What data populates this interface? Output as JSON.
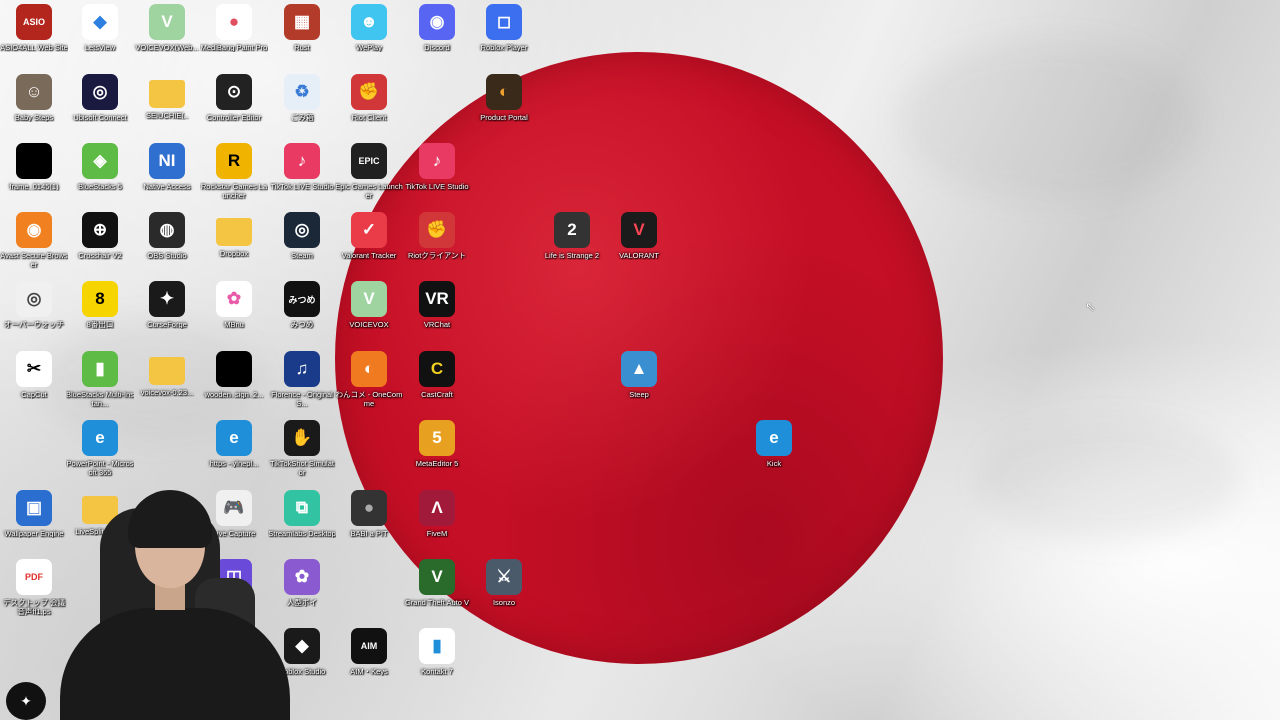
{
  "desktop": {
    "icons": [
      {
        "label": "ASIO4ALL Web Site",
        "text": "ASIO",
        "bg": "#b3261e",
        "fg": "#ffffff"
      },
      {
        "label": "LetsView",
        "text": "◆",
        "bg": "#ffffff",
        "fg": "#2d7fe0"
      },
      {
        "label": "VOICEVOX(Web...",
        "text": "V",
        "bg": "#9fd4a0",
        "fg": "#ffffff"
      },
      {
        "label": "MediBang Paint Pro",
        "text": "●",
        "bg": "#ffffff",
        "fg": "#e04f5f"
      },
      {
        "label": "Rust",
        "text": "▦",
        "bg": "#b33b2a",
        "fg": "#ffffff"
      },
      {
        "label": "WePlay",
        "text": "☻",
        "bg": "#40c4f0",
        "fg": "#ffffff"
      },
      {
        "label": "Discord",
        "text": "◉",
        "bg": "#5865f2",
        "fg": "#ffffff"
      },
      {
        "label": "Roblox Player",
        "text": "◻",
        "bg": "#3b6ff0",
        "fg": "#ffffff"
      },
      {
        "label": "Baby Steps",
        "text": "☺",
        "bg": "#7a6a5a",
        "fg": "#ffffff"
      },
      {
        "label": "Ubisoft Connect",
        "text": "◎",
        "bg": "#1a1a40",
        "fg": "#ffffff"
      },
      {
        "label": "SEIUCHIE(..",
        "text": "",
        "bg": "#f4c542",
        "fg": "#ffffff"
      },
      {
        "label": "Controller Editor",
        "text": "⊙",
        "bg": "#222222",
        "fg": "#ffffff"
      },
      {
        "label": "ごみ箱",
        "text": "♻",
        "bg": "#e6eef8",
        "fg": "#3a7bd5"
      },
      {
        "label": "Riot Client",
        "text": "✊",
        "bg": "#d13639",
        "fg": "#ffffff"
      },
      {
        "label": "Product Portal",
        "text": "◐",
        "bg": "#3a2a1a",
        "fg": "#f0a030"
      },
      {
        "label": "frame_0145(1)",
        "text": "",
        "bg": "#000000",
        "fg": "#ffffff"
      },
      {
        "label": "BlueStacks 5",
        "text": "◈",
        "bg": "#5dbb46",
        "fg": "#ffffff"
      },
      {
        "label": "Native Access",
        "text": "NI",
        "bg": "#2f6fd0",
        "fg": "#ffffff"
      },
      {
        "label": "Rockstar Games Launcher",
        "text": "R",
        "bg": "#f0b400",
        "fg": "#000000"
      },
      {
        "label": "TikTok LIVE Studio",
        "text": "♪",
        "bg": "#e93a63",
        "fg": "#ffffff"
      },
      {
        "label": "Epic Games Launcher",
        "text": "EPIC",
        "bg": "#202020",
        "fg": "#ffffff"
      },
      {
        "label": "TikTok LIVE Studio",
        "text": "♪",
        "bg": "#e93a63",
        "fg": "#ffffff"
      },
      {
        "label": "Avast Secure Browser",
        "text": "◉",
        "bg": "#f08020",
        "fg": "#ffffff"
      },
      {
        "label": "Crosshair V2",
        "text": "⊕",
        "bg": "#111111",
        "fg": "#ffffff"
      },
      {
        "label": "OBS Studio",
        "text": "◍",
        "bg": "#2a2a2a",
        "fg": "#ffffff"
      },
      {
        "label": "Dropbox",
        "text": "",
        "bg": "#f4c542",
        "fg": "#ffffff"
      },
      {
        "label": "Steam",
        "text": "◎",
        "bg": "#1b2838",
        "fg": "#ffffff"
      },
      {
        "label": "Valorant Tracker",
        "text": "✓",
        "bg": "#ea3b48",
        "fg": "#ffffff"
      },
      {
        "label": "Riotクライアント",
        "text": "✊",
        "bg": "#d13639",
        "fg": "#ffffff"
      },
      {
        "label": "Life is Strange 2",
        "text": "2",
        "bg": "#333333",
        "fg": "#ffffff"
      },
      {
        "label": "VALORANT",
        "text": "V",
        "bg": "#1b1b1b",
        "fg": "#ff4655"
      },
      {
        "label": "オーバーウォッチ",
        "text": "◎",
        "bg": "#f0f0f0",
        "fg": "#444444"
      },
      {
        "label": "8番出口",
        "text": "8",
        "bg": "#f5d400",
        "fg": "#000000"
      },
      {
        "label": "CurseForge",
        "text": "✦",
        "bg": "#1a1a1a",
        "fg": "#ffffff"
      },
      {
        "label": "MBnu",
        "text": "✿",
        "bg": "#ffffff",
        "fg": "#e85aa8"
      },
      {
        "label": "みつめ",
        "text": "みつめ",
        "bg": "#111111",
        "fg": "#ffffff"
      },
      {
        "label": "VOICEVOX",
        "text": "V",
        "bg": "#9fd4a0",
        "fg": "#ffffff"
      },
      {
        "label": "VRChat",
        "text": "VR",
        "bg": "#111111",
        "fg": "#ffffff"
      },
      {
        "label": "CapCut",
        "text": "✂",
        "bg": "#ffffff",
        "fg": "#000000"
      },
      {
        "label": "BlueStacks Multi-Instan...",
        "text": "▮",
        "bg": "#5dbb46",
        "fg": "#ffffff"
      },
      {
        "label": "voicevox-0.23...",
        "text": "",
        "bg": "#f4c542",
        "fg": "#ffffff"
      },
      {
        "label": "wooden_sign_2...",
        "text": "",
        "bg": "#000000",
        "fg": "#ffffff"
      },
      {
        "label": "Florence - Original S...",
        "text": "♫",
        "bg": "#1a3a8a",
        "fg": "#ffffff"
      },
      {
        "label": "わんコメ - OneComme",
        "text": "◐",
        "bg": "#f07a20",
        "fg": "#ffffff"
      },
      {
        "label": "CastCraft",
        "text": "C",
        "bg": "#111111",
        "fg": "#f0d020"
      },
      {
        "label": "Steep",
        "text": "▲",
        "bg": "#3a8fd0",
        "fg": "#ffffff"
      },
      {
        "label": "PowerPoint - Microsoft 365",
        "text": "e",
        "bg": "#1e8fd8",
        "fg": "#ffffff"
      },
      {
        "label": "https - ylnepl...",
        "text": "e",
        "bg": "#1e8fd8",
        "fg": "#ffffff"
      },
      {
        "label": "TikTokShot Simulator",
        "text": "✋",
        "bg": "#1a1a1a",
        "fg": "#ffffff"
      },
      {
        "label": "MetaEditor 5",
        "text": "5",
        "bg": "#e8a020",
        "fg": "#ffffff"
      },
      {
        "label": "Kick",
        "text": "e",
        "bg": "#1e8fd8",
        "fg": "#ffffff"
      },
      {
        "label": "Wallpaper Engine",
        "text": "▣",
        "bg": "#2a6fd0",
        "fg": "#ffffff"
      },
      {
        "label": "LiveSplit_1.8...",
        "text": "",
        "bg": "#f4c542",
        "fg": "#ffffff"
      },
      {
        "label": "Live Capture",
        "text": "🎮",
        "bg": "#f0f0f0",
        "fg": "#333333"
      },
      {
        "label": "Streamlabs Desktop",
        "text": "⧉",
        "bg": "#31c3a2",
        "fg": "#ffffff"
      },
      {
        "label": "BABI a PIT",
        "text": "●",
        "bg": "#333333",
        "fg": "#aaaaaa"
      },
      {
        "label": "FiveM",
        "text": "Λ",
        "bg": "#a11a3a",
        "fg": "#ffffff"
      },
      {
        "label": "デスクトップ 会議音声ff1.ps",
        "text": "PDF",
        "bg": "#ffffff",
        "fg": "#e0302a"
      },
      {
        "label": "Options+",
        "text": "◫",
        "bg": "#6a4ad8",
        "fg": "#ffffff"
      },
      {
        "label": "人型ボイ",
        "text": "✿",
        "bg": "#8a5ad0",
        "fg": "#ffffff"
      },
      {
        "label": "Grand Theft Auto V",
        "text": "V",
        "bg": "#2a6a2a",
        "fg": "#ffffff"
      },
      {
        "label": "Isonzo",
        "text": "⚔",
        "bg": "#4a5a6a",
        "fg": "#ffffff"
      },
      {
        "label": "Roblox Studio",
        "text": "◆",
        "bg": "#1a1a1a",
        "fg": "#ffffff"
      },
      {
        "label": "AIM・Keys",
        "text": "AIM",
        "bg": "#111111",
        "fg": "#ffffff"
      },
      {
        "label": "Kontakt 7",
        "text": "▮",
        "bg": "#ffffff",
        "fg": "#1e8fd8"
      }
    ]
  },
  "webcam": {
    "label": "webcam-overlay"
  },
  "corner_logo": {
    "text": "✦"
  }
}
